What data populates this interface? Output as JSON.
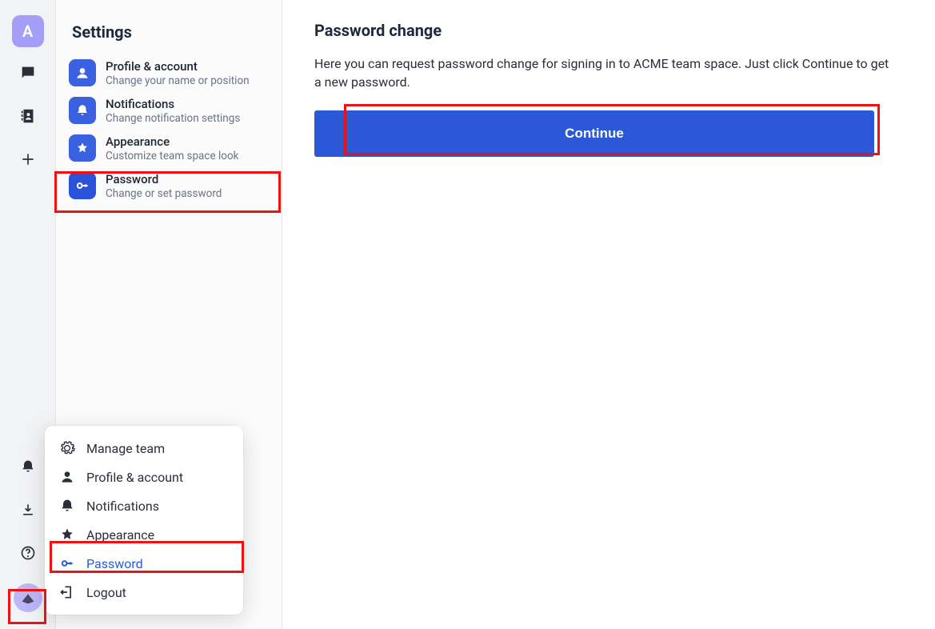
{
  "rail": {
    "workspace_letter": "A"
  },
  "sidebar": {
    "title": "Settings",
    "items": [
      {
        "title": "Profile & account",
        "desc": "Change your name or position"
      },
      {
        "title": "Notifications",
        "desc": "Change notification settings"
      },
      {
        "title": "Appearance",
        "desc": "Customize team space look"
      },
      {
        "title": "Password",
        "desc": "Change or set password"
      }
    ]
  },
  "main": {
    "heading": "Password change",
    "body": "Here you can request password change for signing in to ACME team space. Just click Continue to get a new password.",
    "button": "Continue"
  },
  "popup": {
    "items": [
      "Manage team",
      "Profile & account",
      "Notifications",
      "Appearance",
      "Password",
      "Logout"
    ]
  }
}
